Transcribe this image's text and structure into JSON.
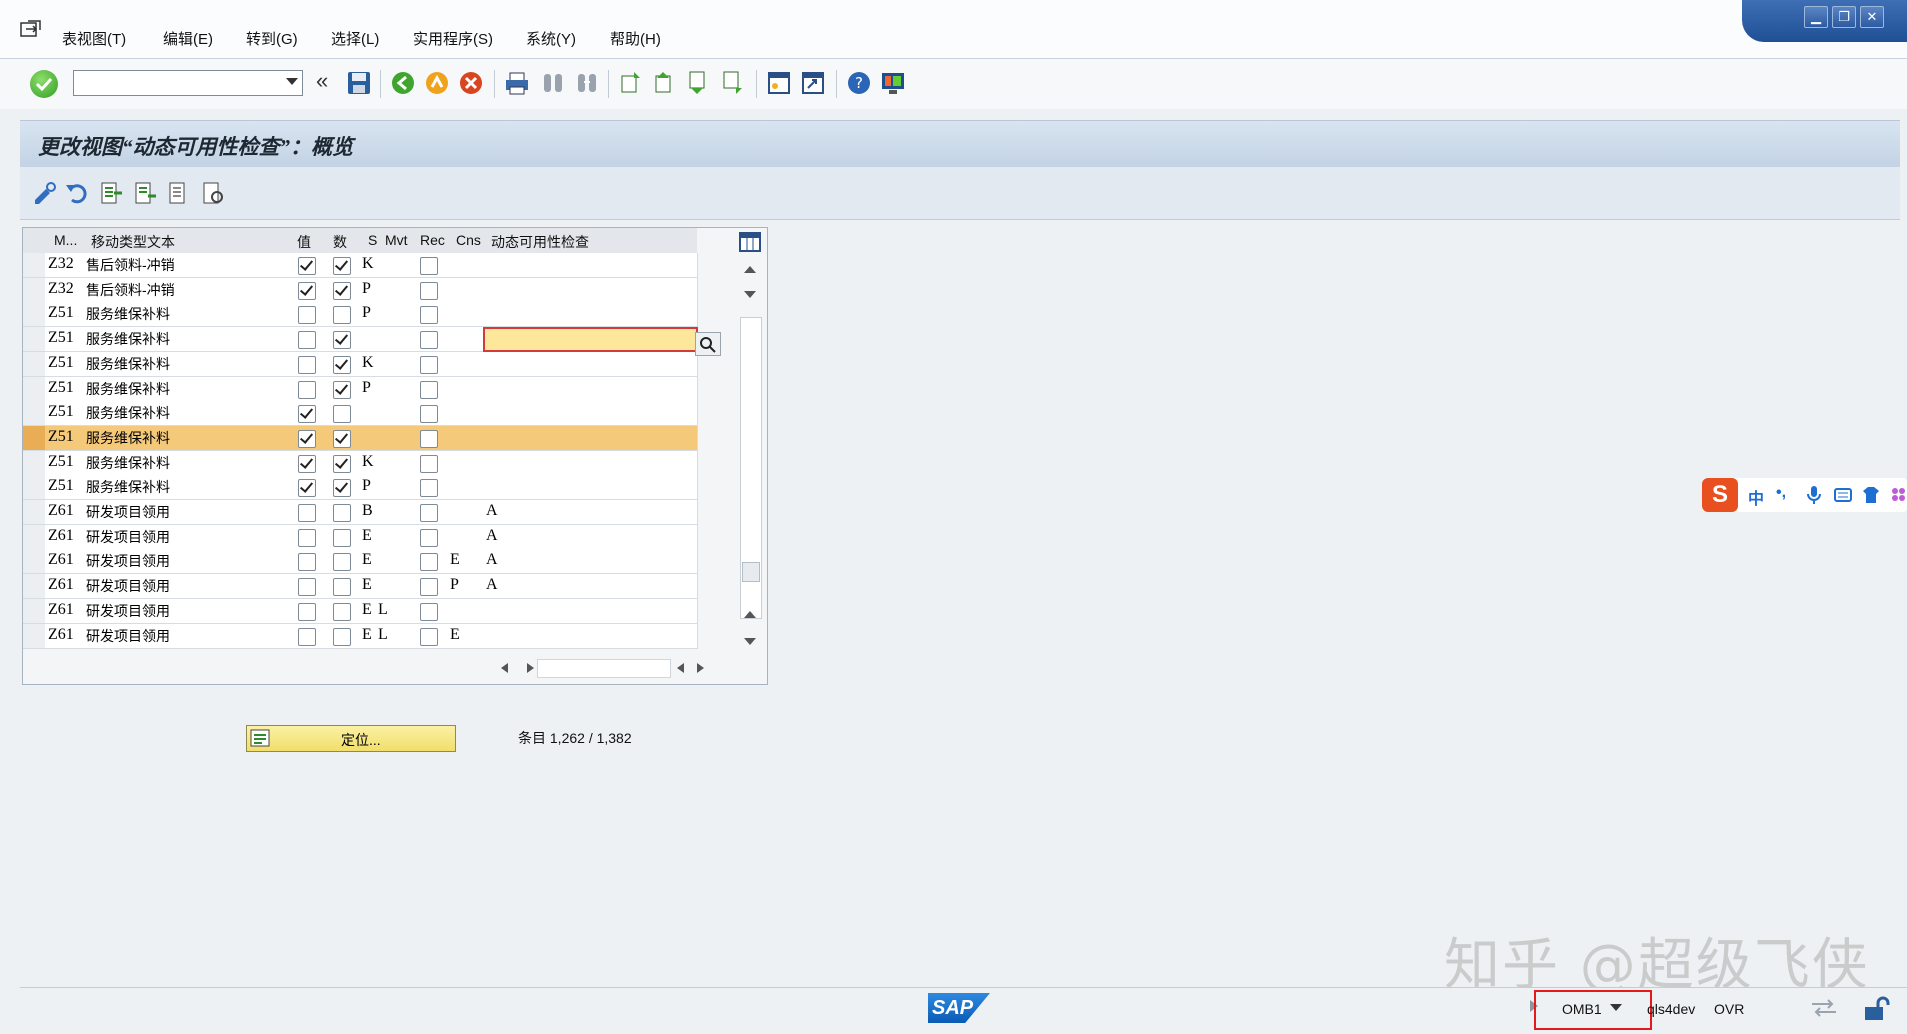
{
  "menu": [
    {
      "label": "表视图(T)"
    },
    {
      "label": "编辑(E)"
    },
    {
      "label": "转到(G)"
    },
    {
      "label": "选择(L)"
    },
    {
      "label": "实用程序(S)"
    },
    {
      "label": "系统(Y)"
    },
    {
      "label": "帮助(H)"
    }
  ],
  "window_controls": {
    "minimize": "▁",
    "restore": "❐",
    "close": "✕"
  },
  "toolbar": {
    "command_field_value": "",
    "back_label": "«"
  },
  "title": "更改视图“动态可用性检查”：概览",
  "table": {
    "columns": [
      "M...",
      "移动类型文本",
      "值",
      "数",
      "S",
      "Mvt",
      "Rec",
      "Cns",
      "动态可用性检查"
    ],
    "rows": [
      {
        "m": "Z32",
        "text": "售后领料-冲销",
        "value": true,
        "qty": true,
        "s": "K",
        "mvt": "",
        "rec": false,
        "cns": "",
        "check": ""
      },
      {
        "m": "Z32",
        "text": "售后领料-冲销",
        "value": true,
        "qty": true,
        "s": "P",
        "mvt": "",
        "rec": false,
        "cns": "",
        "check": ""
      },
      {
        "m": "Z51",
        "text": "服务维保补料",
        "value": false,
        "qty": false,
        "s": "P",
        "mvt": "",
        "rec": false,
        "cns": "",
        "check": ""
      },
      {
        "m": "Z51",
        "text": "服务维保补料",
        "value": false,
        "qty": true,
        "s": "",
        "mvt": "",
        "rec": false,
        "cns": "",
        "check": "",
        "focused": true
      },
      {
        "m": "Z51",
        "text": "服务维保补料",
        "value": false,
        "qty": true,
        "s": "K",
        "mvt": "",
        "rec": false,
        "cns": "",
        "check": ""
      },
      {
        "m": "Z51",
        "text": "服务维保补料",
        "value": false,
        "qty": true,
        "s": "P",
        "mvt": "",
        "rec": false,
        "cns": "",
        "check": ""
      },
      {
        "m": "Z51",
        "text": "服务维保补料",
        "value": true,
        "qty": false,
        "s": "",
        "mvt": "",
        "rec": false,
        "cns": "",
        "check": ""
      },
      {
        "m": "Z51",
        "text": "服务维保补料",
        "value": true,
        "qty": true,
        "s": "",
        "mvt": "",
        "rec": false,
        "cns": "",
        "check": "",
        "highlighted": true
      },
      {
        "m": "Z51",
        "text": "服务维保补料",
        "value": true,
        "qty": true,
        "s": "K",
        "mvt": "",
        "rec": false,
        "cns": "",
        "check": ""
      },
      {
        "m": "Z51",
        "text": "服务维保补料",
        "value": true,
        "qty": true,
        "s": "P",
        "mvt": "",
        "rec": false,
        "cns": "",
        "check": ""
      },
      {
        "m": "Z61",
        "text": "研发项目领用",
        "value": false,
        "qty": false,
        "s": "B",
        "mvt": "",
        "rec": false,
        "cns": "",
        "check": "A"
      },
      {
        "m": "Z61",
        "text": "研发项目领用",
        "value": false,
        "qty": false,
        "s": "E",
        "mvt": "",
        "rec": false,
        "cns": "",
        "check": "A"
      },
      {
        "m": "Z61",
        "text": "研发项目领用",
        "value": false,
        "qty": false,
        "s": "E",
        "mvt": "",
        "rec": false,
        "cns": "E",
        "check": "A"
      },
      {
        "m": "Z61",
        "text": "研发项目领用",
        "value": false,
        "qty": false,
        "s": "E",
        "mvt": "",
        "rec": false,
        "cns": "P",
        "check": "A"
      },
      {
        "m": "Z61",
        "text": "研发项目领用",
        "value": false,
        "qty": false,
        "s": "E",
        "mvt": "L",
        "rec": false,
        "cns": "",
        "check": ""
      },
      {
        "m": "Z61",
        "text": "研发项目领用",
        "value": false,
        "qty": false,
        "s": "E",
        "mvt": "L",
        "rec": false,
        "cns": "E",
        "check": ""
      }
    ]
  },
  "position_button": {
    "label": "定位..."
  },
  "entry_count": "条目 1,262 / 1,382",
  "status": {
    "sap_logo": "SAP",
    "transaction": "OMB1",
    "server": "qls4dev",
    "mode": "OVR"
  },
  "ime": {
    "lang": "中",
    "punct": "•,"
  },
  "watermark": "知乎 @超级飞侠",
  "colors": {
    "highlight_row": "#f5c97a",
    "focus_field": "#fde79a",
    "title_bar": "#c3d3e4",
    "position_button": "#f1de6b",
    "status_box": "#e41a1a"
  }
}
